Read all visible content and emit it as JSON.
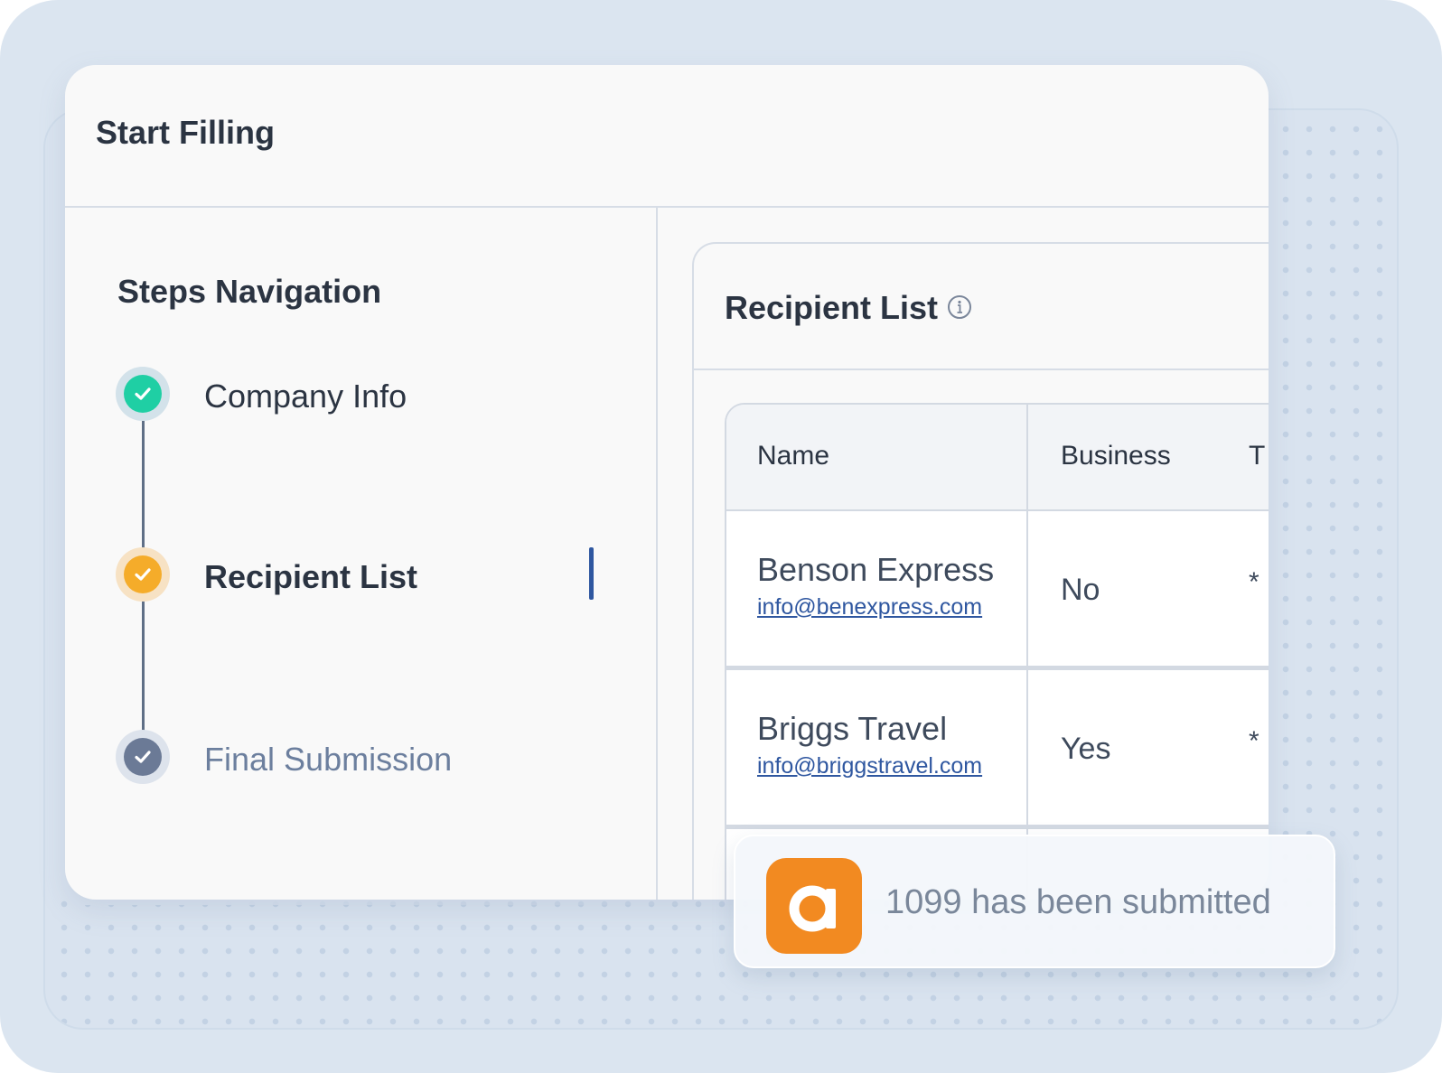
{
  "header": {
    "title": "Start Filling"
  },
  "sidebar": {
    "title": "Steps Navigation",
    "steps": [
      {
        "label": "Company Info",
        "status": "complete",
        "color": "#1fcfa4"
      },
      {
        "label": "Recipient List",
        "status": "active",
        "color": "#f5ac2a"
      },
      {
        "label": "Final Submission",
        "status": "pending",
        "color": "#6b7a96"
      }
    ]
  },
  "recipient_list": {
    "title": "Recipient List",
    "info_icon": "info-icon",
    "columns": [
      "Name",
      "Business",
      "T"
    ],
    "rows": [
      {
        "name": "Benson Express",
        "email": "info@benexpress.com",
        "business": "No",
        "third": "*"
      },
      {
        "name": "Briggs Travel",
        "email": "info@briggstravel.com",
        "business": "Yes",
        "third": "*"
      }
    ]
  },
  "toast": {
    "logo_letter": "a",
    "message": "1099 has been submitted",
    "logo_color": "#f28a21"
  },
  "colors": {
    "accent": "#2f57a0",
    "text": "#2b3442",
    "background": "#dbe5f0"
  }
}
